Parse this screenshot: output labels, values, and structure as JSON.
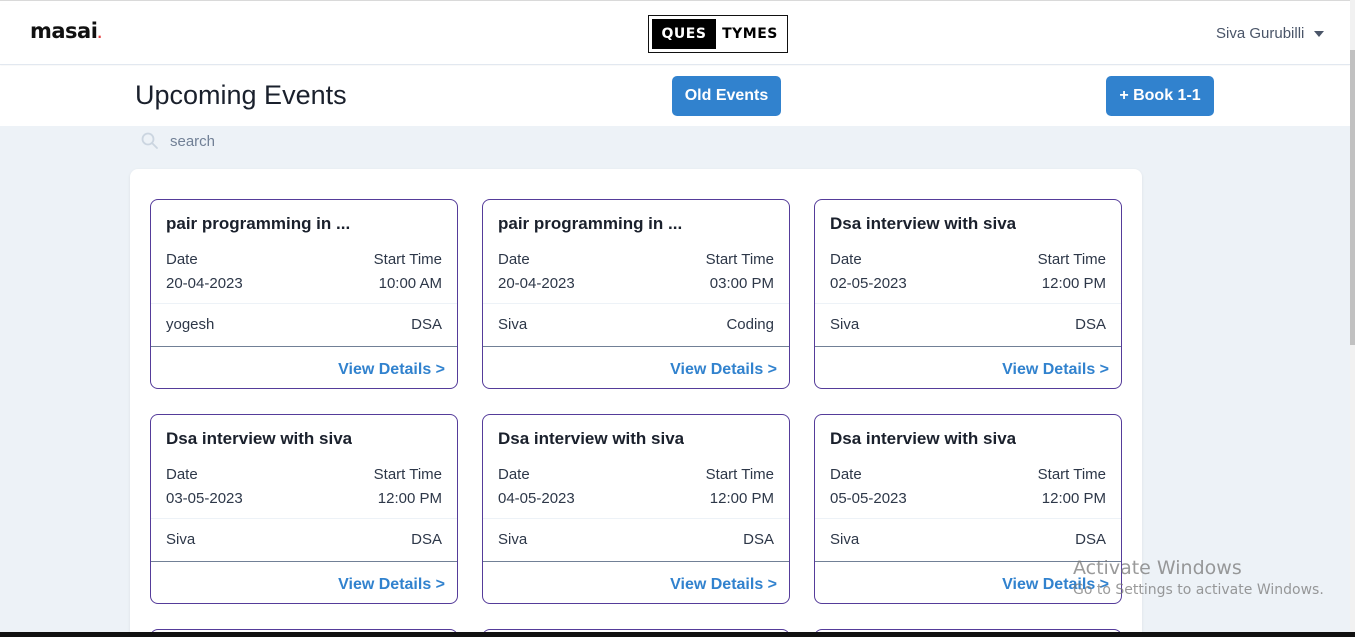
{
  "navbar": {
    "logo_text": "masai",
    "logo_dot": ".",
    "brand_left": "QUES",
    "brand_right": "TYMES",
    "user_name": "Siva Gurubilli"
  },
  "header": {
    "title": "Upcoming Events",
    "old_events_label": "Old Events",
    "book_label": "+ Book 1-1"
  },
  "search": {
    "placeholder": "search"
  },
  "card_labels": {
    "date": "Date",
    "start_time": "Start Time",
    "view_details": "View Details >"
  },
  "events": [
    {
      "title": "pair programming in ...",
      "date": "20-04-2023",
      "time": "10:00 AM",
      "host": "yogesh",
      "category": "DSA"
    },
    {
      "title": "pair programming in ...",
      "date": "20-04-2023",
      "time": "03:00 PM",
      "host": "Siva",
      "category": "Coding"
    },
    {
      "title": "Dsa interview with siva",
      "date": "02-05-2023",
      "time": "12:00 PM",
      "host": "Siva",
      "category": "DSA"
    },
    {
      "title": "Dsa interview with siva",
      "date": "03-05-2023",
      "time": "12:00 PM",
      "host": "Siva",
      "category": "DSA"
    },
    {
      "title": "Dsa interview with siva",
      "date": "04-05-2023",
      "time": "12:00 PM",
      "host": "Siva",
      "category": "DSA"
    },
    {
      "title": "Dsa interview with siva",
      "date": "05-05-2023",
      "time": "12:00 PM",
      "host": "Siva",
      "category": "DSA"
    }
  ],
  "watermark": {
    "title": "Activate Windows",
    "subtitle": "Go to Settings to activate Windows."
  },
  "colors": {
    "accent": "#3182ce",
    "card_border": "#553c9a",
    "background": "#edf2f7"
  }
}
